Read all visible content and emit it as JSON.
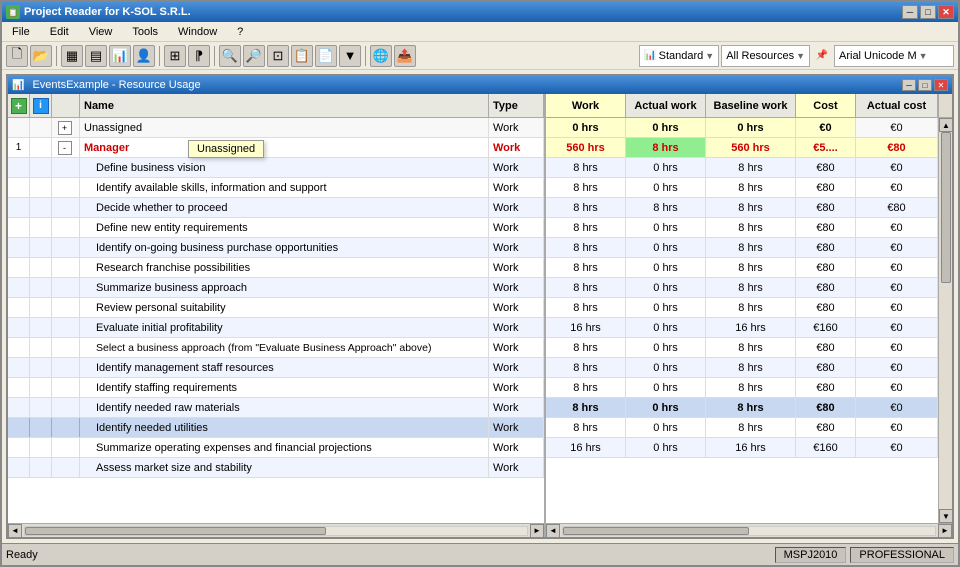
{
  "window": {
    "title": "Project Reader for K-SOL S.R.L.",
    "title_icon": "📋",
    "min_btn": "─",
    "max_btn": "□",
    "close_btn": "✕"
  },
  "menu": {
    "items": [
      "File",
      "Edit",
      "View",
      "Tools",
      "Window",
      "?"
    ]
  },
  "toolbar": {
    "standard_label": "Standard",
    "resources_label": "All Resources",
    "font_label": "Arial Unicode M"
  },
  "subwindow": {
    "title": "EventsExample - Resource Usage"
  },
  "table": {
    "left_cols": [
      "",
      "",
      "Name",
      "Type"
    ],
    "right_cols": [
      "Work",
      "Actual work",
      "Baseline work",
      "Cost",
      "Actual cost"
    ],
    "rows": [
      {
        "num": "",
        "indent": 0,
        "expander": "+",
        "name": "Unassigned",
        "type": "Work",
        "work": "0 hrs",
        "actual_work": "0 hrs",
        "baseline_work": "0 hrs",
        "cost": "€0",
        "actual_cost": "€0",
        "style": "unassigned",
        "work_bold": true
      },
      {
        "num": "1",
        "indent": 0,
        "expander": "-",
        "name": "Manager",
        "type": "Work",
        "work": "560 hrs",
        "actual_work": "8 hrs",
        "baseline_work": "560 hrs",
        "cost": "€5....",
        "actual_cost": "€80",
        "style": "manager",
        "work_bold": true,
        "tooltip": "Unassigned"
      },
      {
        "num": "",
        "indent": 1,
        "name": "Define business vision",
        "type": "Work",
        "work": "8 hrs",
        "actual_work": "0 hrs",
        "baseline_work": "8 hrs",
        "cost": "€80",
        "actual_cost": "€0",
        "style": "normal"
      },
      {
        "num": "",
        "indent": 1,
        "name": "Identify available skills, information and support",
        "type": "Work",
        "work": "8 hrs",
        "actual_work": "0 hrs",
        "baseline_work": "8 hrs",
        "cost": "€80",
        "actual_cost": "€0",
        "style": "normal"
      },
      {
        "num": "",
        "indent": 1,
        "name": "Decide whether to proceed",
        "type": "Work",
        "work": "8 hrs",
        "actual_work": "8 hrs",
        "baseline_work": "8 hrs",
        "cost": "€80",
        "actual_cost": "€80",
        "style": "normal"
      },
      {
        "num": "",
        "indent": 1,
        "name": "Define new entity requirements",
        "type": "Work",
        "work": "8 hrs",
        "actual_work": "0 hrs",
        "baseline_work": "8 hrs",
        "cost": "€80",
        "actual_cost": "€0",
        "style": "normal"
      },
      {
        "num": "",
        "indent": 1,
        "name": "Identify on-going business purchase opportunities",
        "type": "Work",
        "work": "8 hrs",
        "actual_work": "0 hrs",
        "baseline_work": "8 hrs",
        "cost": "€80",
        "actual_cost": "€0",
        "style": "normal"
      },
      {
        "num": "",
        "indent": 1,
        "name": "Research franchise possibilities",
        "type": "Work",
        "work": "8 hrs",
        "actual_work": "0 hrs",
        "baseline_work": "8 hrs",
        "cost": "€80",
        "actual_cost": "€0",
        "style": "normal"
      },
      {
        "num": "",
        "indent": 1,
        "name": "Summarize business approach",
        "type": "Work",
        "work": "8 hrs",
        "actual_work": "0 hrs",
        "baseline_work": "8 hrs",
        "cost": "€80",
        "actual_cost": "€0",
        "style": "normal"
      },
      {
        "num": "",
        "indent": 1,
        "name": "Review personal suitability",
        "type": "Work",
        "work": "8 hrs",
        "actual_work": "0 hrs",
        "baseline_work": "8 hrs",
        "cost": "€80",
        "actual_cost": "€0",
        "style": "normal"
      },
      {
        "num": "",
        "indent": 1,
        "name": "Evaluate initial profitability",
        "type": "Work",
        "work": "8 hrs",
        "actual_work": "0 hrs",
        "baseline_work": "8 hrs",
        "cost": "€80",
        "actual_cost": "€0",
        "style": "normal"
      },
      {
        "num": "",
        "indent": 1,
        "name": "Select a business approach (from \"Evaluate Business Approach\" above)",
        "type": "Work",
        "work": "16 hrs",
        "actual_work": "0 hrs",
        "baseline_work": "16 hrs",
        "cost": "€160",
        "actual_cost": "€0",
        "style": "normal"
      },
      {
        "num": "",
        "indent": 1,
        "name": "Identify management staff resources",
        "type": "Work",
        "work": "8 hrs",
        "actual_work": "0 hrs",
        "baseline_work": "8 hrs",
        "cost": "€80",
        "actual_cost": "€0",
        "style": "normal"
      },
      {
        "num": "",
        "indent": 1,
        "name": "Identify staffing requirements",
        "type": "Work",
        "work": "8 hrs",
        "actual_work": "0 hrs",
        "baseline_work": "8 hrs",
        "cost": "€80",
        "actual_cost": "€0",
        "style": "normal"
      },
      {
        "num": "",
        "indent": 1,
        "name": "Identify needed raw materials",
        "type": "Work",
        "work": "8 hrs",
        "actual_work": "0 hrs",
        "baseline_work": "8 hrs",
        "cost": "€80",
        "actual_cost": "€0",
        "style": "normal"
      },
      {
        "num": "",
        "indent": 1,
        "name": "Identify needed utilities",
        "type": "Work",
        "work": "8 hrs",
        "actual_work": "0 hrs",
        "baseline_work": "8 hrs",
        "cost": "€80",
        "actual_cost": "€0",
        "style": "highlighted"
      },
      {
        "num": "",
        "indent": 1,
        "name": "Summarize operating expenses and financial projections",
        "type": "Work",
        "work": "8 hrs",
        "actual_work": "0 hrs",
        "baseline_work": "8 hrs",
        "cost": "€80",
        "actual_cost": "€0",
        "style": "normal"
      },
      {
        "num": "",
        "indent": 1,
        "name": "Assess market size and stability",
        "type": "Work",
        "work": "16 hrs",
        "actual_work": "0 hrs",
        "baseline_work": "16 hrs",
        "cost": "€160",
        "actual_cost": "€0",
        "style": "normal"
      }
    ]
  },
  "status": {
    "ready": "Ready",
    "badge1": "MSPJ2010",
    "badge2": "PROFESSIONAL"
  },
  "colors": {
    "work_col_bg": "#ffffcc",
    "manager_name_color": "#cc0000",
    "highlight_row_bg": "#c8d8f0",
    "work_highlight": "#ffffcc"
  }
}
